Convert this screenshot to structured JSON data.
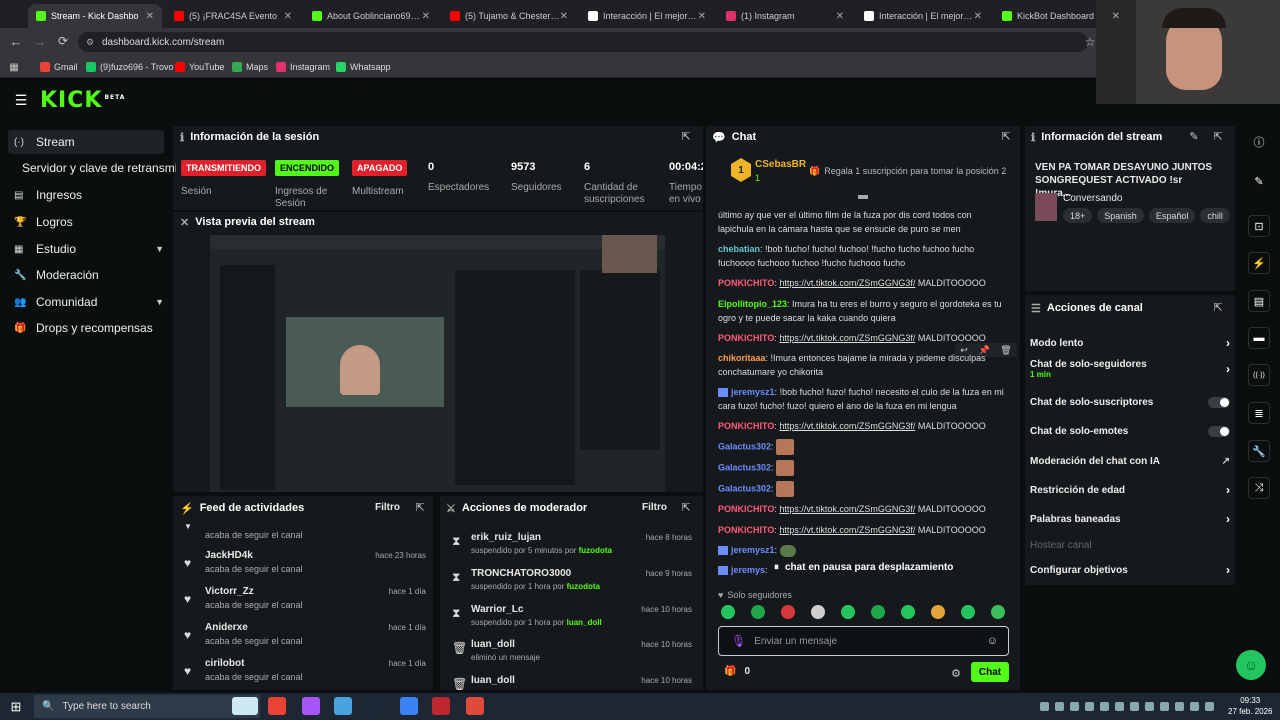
{
  "browser": {
    "tabs": [
      {
        "label": "Stream - Kick Dashbo",
        "color": "#53fc18",
        "active": true
      },
      {
        "label": "(5) ¡FRAC4SA Evento",
        "color": "#ff0000"
      },
      {
        "label": "About Goblinciano69 - W",
        "color": "#53fc18"
      },
      {
        "label": "(5) Tujamo & Chester You",
        "color": "#ff0000"
      },
      {
        "label": "Interacción | El mejor soft",
        "color": "#ffffff"
      },
      {
        "label": "(1) Instagram",
        "color": "#e1306c"
      },
      {
        "label": "Interacción | El mejor soft",
        "color": "#ffffff"
      },
      {
        "label": "KickBot Dashboard",
        "color": "#53fc18"
      }
    ],
    "url": "dashboard.kick.com/stream",
    "bookmarks": [
      "Gmail",
      "(9)fuzo696 - Trovo",
      "YouTube",
      "Maps",
      "Instagram",
      "Whatsapp"
    ]
  },
  "kick": {
    "logo": "KICK",
    "beta": "BETA"
  },
  "sidebar": {
    "items": [
      {
        "label": "Stream",
        "icon": "stream-icon"
      },
      {
        "label": "Servidor y clave de retransmisión",
        "icon": ""
      },
      {
        "label": "Ingresos",
        "icon": "income-icon"
      },
      {
        "label": "Logros",
        "icon": "trophy-icon"
      },
      {
        "label": "Estudio",
        "icon": "studio-icon"
      },
      {
        "label": "Moderación",
        "icon": "wrench-icon"
      },
      {
        "label": "Comunidad",
        "icon": "users-icon"
      },
      {
        "label": "Drops y recompensas",
        "icon": "gift-icon"
      }
    ]
  },
  "session": {
    "title": "Información de la sesión",
    "badges": [
      {
        "text": "TRANSMITIENDO",
        "label": "Sesión"
      },
      {
        "text": "ENCENDIDO",
        "label": "Ingresos de Sesión"
      },
      {
        "text": "APAGADO",
        "label": "Multistream"
      }
    ],
    "stats": [
      {
        "value": "0",
        "label": "Espectadores"
      },
      {
        "value": "9573",
        "label": "Seguidores"
      },
      {
        "value": "6",
        "label": "Cantidad de suscripciones"
      },
      {
        "value": "00:04:2",
        "label": "Tiempo en vivo"
      }
    ]
  },
  "preview": {
    "title": "Vista previa del stream"
  },
  "feed": {
    "title": "Feed de actividades",
    "filter": "Filtro",
    "items": [
      {
        "name": "",
        "time": "",
        "text": "acaba de seguir el canal"
      },
      {
        "name": "JackHD4k",
        "time": "hace 23 horas",
        "text": "acaba de seguir el canal"
      },
      {
        "name": "Victorr_Zz",
        "time": "hace 1 día",
        "text": "acaba de seguir el canal"
      },
      {
        "name": "Aniderxe",
        "time": "hace 1 día",
        "text": "acaba de seguir el canal"
      },
      {
        "name": "cirilobot",
        "time": "hace 1 día",
        "text": "acaba de seguir el canal"
      }
    ]
  },
  "modactions": {
    "title": "Acciones de moderador",
    "filter": "Filtro",
    "items": [
      {
        "name": "erik_ruiz_lujan",
        "time": "hace 8 horas",
        "pre": "suspendido por 5 minutos por ",
        "by": "fuzodota"
      },
      {
        "name": "TRONCHATORO3000",
        "time": "hace 9 horas",
        "pre": "suspendido por 1 hora por ",
        "by": "fuzodota"
      },
      {
        "name": "Warrior_Lc",
        "time": "hace 10 horas",
        "pre": "suspendido por 1 hora por ",
        "by": "luan_doll"
      },
      {
        "name": "luan_doll",
        "time": "hace 10 horas",
        "pre": "eliminó un mensaje",
        "by": ""
      },
      {
        "name": "luan_doll",
        "time": "hace 10 horas",
        "pre": "",
        "by": ""
      }
    ]
  },
  "chat": {
    "title": "Chat",
    "pinned": {
      "user": "CSebasBR",
      "sub": "1",
      "gift": "Regala 1 suscripción para tomar la posición 2"
    },
    "messages": [
      {
        "user": "",
        "color": "#ddd",
        "text": "último ay que ver el último film de la fuza por dis cord todos con lapichula en la cámara hasta que se ensucie de puro se men"
      },
      {
        "user": "chebatian",
        "color": "#5ec7d7",
        "text": "!bob fucho! fucho! fuchoo! !fucho fucho fuchoo fucho fuchoooo fuchooo fuchoo !fucho fuchooo fucho"
      },
      {
        "user": "PONKICHITO",
        "color": "#ff5a7a",
        "link": "https://vt.tiktok.com/ZSmGGNG3f/",
        "text": " MALDITOOOOO"
      },
      {
        "user": "Elpollitopio_123",
        "color": "#53fc18",
        "text": "Imura ha tu eres el burro y seguro el gordoteka es tu ogro y te puede sacar la kaka cuando quiera"
      },
      {
        "user": "PONKICHITO",
        "color": "#ff5a7a",
        "link": "https://vt.tiktok.com/ZSmGGNG3f/",
        "text": " MALDITOOOOO"
      },
      {
        "user": "chikoritaaa",
        "color": "#ff9a4a",
        "text": "!Imura entonces bajame la mirada y pideme disculpas conchatumare yo chikorita"
      },
      {
        "user": "jeremysz1",
        "color": "#6b8cff",
        "text": "!bob fucho! fuzo! fucho! necesito el culo de la fuza en mi cara fuzo! fucho! fuzo! quiero el ano de la fuza en mi lengua"
      },
      {
        "user": "PONKICHITO",
        "color": "#ff5a7a",
        "link": "https://vt.tiktok.com/ZSmGGNG3f/",
        "text": " MALDITOOOOO"
      },
      {
        "user": "Galactus302",
        "color": "#6b8cff",
        "text": ""
      },
      {
        "user": "Galactus302",
        "color": "#6b8cff",
        "text": ""
      },
      {
        "user": "Galactus302",
        "color": "#6b8cff",
        "text": ""
      },
      {
        "user": "PONKICHITO",
        "color": "#ff5a7a",
        "link": "https://vt.tiktok.com/ZSmGGNG3f/",
        "text": " MALDITOOOOO"
      },
      {
        "user": "PONKICHITO",
        "color": "#ff5a7a",
        "link": "https://vt.tiktok.com/ZSmGGNG3f/",
        "text": " MALDITOOOOO"
      },
      {
        "user": "jeremysz1",
        "color": "#6b8cff",
        "text": ""
      },
      {
        "user": "jeremys",
        "color": "#6b8cff",
        "text": ""
      }
    ],
    "paused": "chat en pausa para desplazamiento",
    "mode": "Solo seguidores",
    "placeholder": "Enviar un mensaje",
    "points": "0",
    "send": "Chat"
  },
  "streaminfo": {
    "title": "Información del stream",
    "headline": "VEN PA TOMAR DESAYUNO JUNTOS SONGREQUEST ACTIVADO !sr !mura...",
    "category": "Conversando",
    "tags": [
      "18+",
      "Spanish",
      "Español",
      "chill"
    ]
  },
  "channel": {
    "title": "Acciones de canal",
    "rows": [
      {
        "label": "Modo lento",
        "ctrl": "chevron"
      },
      {
        "label": "Chat de solo-seguidores",
        "sub": "1 min",
        "ctrl": "chevron"
      },
      {
        "label": "Chat de solo-suscriptores",
        "ctrl": "toggle"
      },
      {
        "label": "Chat de solo-emotes",
        "ctrl": "toggle"
      },
      {
        "label": "Moderación del chat con IA",
        "ctrl": "ext"
      },
      {
        "label": "Restricción de edad",
        "ctrl": "chevron"
      },
      {
        "label": "Palabras baneadas",
        "ctrl": "chevron"
      },
      {
        "label": "Hostear canal",
        "ctrl": "none",
        "dim": true
      },
      {
        "label": "Configurar objetivos",
        "ctrl": "chevron"
      }
    ]
  },
  "taskbar": {
    "search": "Type here to search",
    "time": "09:33",
    "date": "27 feb. 2026"
  }
}
